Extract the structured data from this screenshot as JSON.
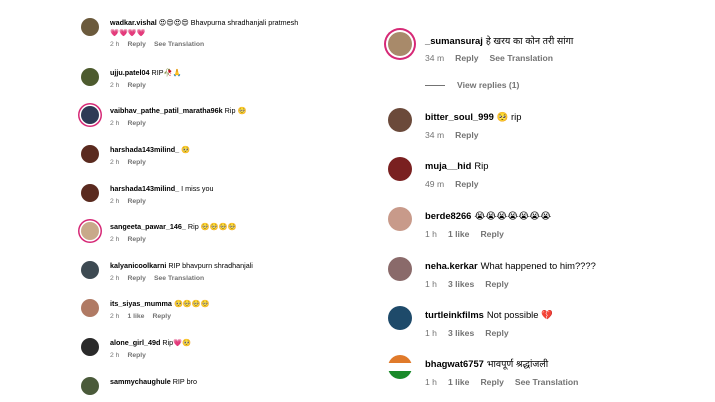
{
  "left_comments": [
    {
      "user": "wadkar.vishal",
      "text": "😍😍😍😍 Bhavpurna shradhanjali pratmesh",
      "text2": "💗💗💗💗",
      "time": "2 h",
      "likes": "",
      "reply": "Reply",
      "translate": "See Translation",
      "story_ring": false,
      "avatar_color": "#6b5a3c"
    },
    {
      "user": "ujju.patel04",
      "text": "RIP🥀🙏",
      "time": "2 h",
      "likes": "",
      "reply": "Reply",
      "translate": "",
      "story_ring": false,
      "avatar_color": "#4d5b2e"
    },
    {
      "user": "vaibhav_pathe_patil_maratha96k",
      "text": "Rip 🥺",
      "time": "2 h",
      "likes": "",
      "reply": "Reply",
      "translate": "",
      "story_ring": true,
      "avatar_color": "#2d3a55"
    },
    {
      "user": "harshada143milind_",
      "text": "🥺",
      "time": "2 h",
      "likes": "",
      "reply": "Reply",
      "translate": "",
      "story_ring": false,
      "avatar_color": "#5a2a1f"
    },
    {
      "user": "harshada143milind_",
      "text": "I miss you",
      "time": "2 h",
      "likes": "",
      "reply": "Reply",
      "translate": "",
      "story_ring": false,
      "avatar_color": "#5a2a1f"
    },
    {
      "user": "sangeeta_pawar_146_",
      "text": "Rip 🥺🥺🥺🥺",
      "time": "2 h",
      "likes": "",
      "reply": "Reply",
      "translate": "",
      "story_ring": true,
      "avatar_color": "#c8a98a"
    },
    {
      "user": "kalyanicoolkarni",
      "text": "RIP bhavpurn shradhanjali",
      "time": "2 h",
      "likes": "",
      "reply": "Reply",
      "translate": "See Translation",
      "story_ring": false,
      "avatar_color": "#3d4a52"
    },
    {
      "user": "its_siyas_mumma",
      "text": "🥺🥺🥺🥺",
      "time": "2 h",
      "likes": "1 like",
      "reply": "Reply",
      "translate": "",
      "story_ring": false,
      "avatar_color": "#b07a64"
    },
    {
      "user": "alone_girl_49d",
      "text": "Rip💗🥺",
      "time": "2 h",
      "likes": "",
      "reply": "Reply",
      "translate": "",
      "story_ring": false,
      "avatar_color": "#2a2a2a"
    },
    {
      "user": "sammychaughule",
      "text": "RIP bro",
      "time": "",
      "likes": "",
      "reply": "",
      "translate": "",
      "story_ring": false,
      "avatar_color": "#4a5a3a"
    }
  ],
  "right_comments": [
    {
      "user": "_sumansuraj",
      "text": "हे खरय का कोन तरी सांगा",
      "time": "34 m",
      "likes": "",
      "reply": "Reply",
      "translate": "See Translation",
      "story_ring": true,
      "avatar_color": "#a88a6a"
    },
    {
      "user": "bitter_soul_999",
      "text": "🥺 rip",
      "time": "34 m",
      "likes": "",
      "reply": "Reply",
      "translate": "",
      "story_ring": false,
      "avatar_color": "#6b4a3a"
    },
    {
      "user": "muja__hid",
      "text": "Rip",
      "time": "49 m",
      "likes": "",
      "reply": "Reply",
      "translate": "",
      "story_ring": false,
      "avatar_color": "#7a2020"
    },
    {
      "user": "berde8266",
      "text": "😭😭😭😭😭😭😭",
      "time": "1 h",
      "likes": "1 like",
      "reply": "Reply",
      "translate": "",
      "story_ring": false,
      "avatar_color": "#c89a8a"
    },
    {
      "user": "neha.kerkar",
      "text": "What happened to him????",
      "time": "1 h",
      "likes": "3 likes",
      "reply": "Reply",
      "translate": "",
      "story_ring": false,
      "avatar_color": "#8a6a6a"
    },
    {
      "user": "turtleinkfilms",
      "text": "Not possible 💔",
      "time": "1 h",
      "likes": "3 likes",
      "reply": "Reply",
      "translate": "",
      "story_ring": false,
      "avatar_color": "#1e4a6a"
    },
    {
      "user": "bhagwat6757",
      "text": "भावपूर्ण श्रद्धांजली",
      "time": "1 h",
      "likes": "1 like",
      "reply": "Reply",
      "translate": "See Translation",
      "story_ring": false,
      "avatar_color": "#e07a2a"
    }
  ],
  "view_replies": "View replies (1)"
}
